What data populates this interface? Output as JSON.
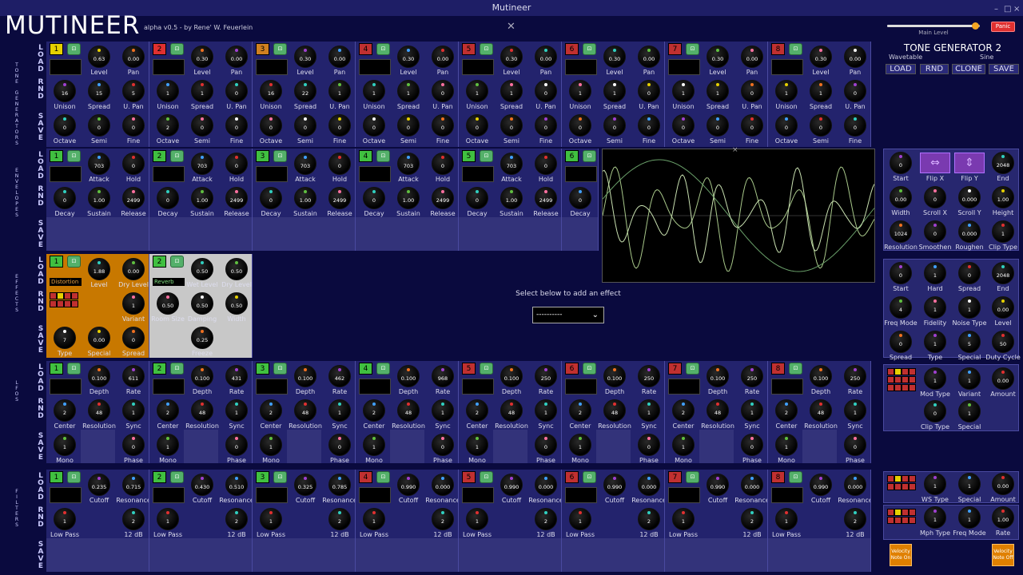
{
  "window": {
    "title": "Mutineer",
    "controls": [
      "–",
      "□",
      "×"
    ]
  },
  "header": {
    "app_title": "MUTINEER",
    "version": "alpha v0.5 - by Rene' W. Feuerlein",
    "main_level_label": "Main Level",
    "main_level": 0.95,
    "panic": "Panic"
  },
  "rows": {
    "load": "LOAD",
    "rnd": "RND",
    "save": "SAVE",
    "generators": "TONE GENERATORS",
    "envelopes": "ENVELOPES",
    "effects": "EFFECTS",
    "lfos": "LFOS",
    "filters": "FILTERS"
  },
  "generators": [
    {
      "n": "1",
      "c": "#e6d000",
      "k": [
        [
          "0.63",
          "Level"
        ],
        [
          "0.00",
          "Pan"
        ],
        [
          "16",
          "Unison"
        ],
        [
          "15",
          "Spread"
        ],
        [
          "5",
          "U. Pan"
        ],
        [
          "0",
          "Octave"
        ],
        [
          "0",
          "Semi"
        ],
        [
          "0",
          "Fine"
        ]
      ]
    },
    {
      "n": "2",
      "c": "#e03030",
      "k": [
        [
          "0.30",
          "Level"
        ],
        [
          "0.00",
          "Pan"
        ],
        [
          "1",
          "Unison"
        ],
        [
          "1",
          "Spread"
        ],
        [
          "0",
          "U. Pan"
        ],
        [
          "2",
          "Octave"
        ],
        [
          "0",
          "Semi"
        ],
        [
          "0",
          "Fine"
        ]
      ]
    },
    {
      "n": "3",
      "c": "#d08020",
      "k": [
        [
          "0.30",
          "Level"
        ],
        [
          "0.00",
          "Pan"
        ],
        [
          "16",
          "Unison"
        ],
        [
          "22",
          "Spread"
        ],
        [
          "1",
          "U. Pan"
        ],
        [
          "0",
          "Octave"
        ],
        [
          "0",
          "Semi"
        ],
        [
          "0",
          "Fine"
        ]
      ]
    },
    {
      "n": "4",
      "c": "#c03030",
      "k": [
        [
          "0.30",
          "Level"
        ],
        [
          "0.00",
          "Pan"
        ],
        [
          "1",
          "Unison"
        ],
        [
          "1",
          "Spread"
        ],
        [
          "0",
          "U. Pan"
        ],
        [
          "0",
          "Octave"
        ],
        [
          "0",
          "Semi"
        ],
        [
          "0",
          "Fine"
        ]
      ]
    },
    {
      "n": "5",
      "c": "#c03030",
      "k": [
        [
          "0.30",
          "Level"
        ],
        [
          "0.00",
          "Pan"
        ],
        [
          "1",
          "Unison"
        ],
        [
          "1",
          "Spread"
        ],
        [
          "0",
          "U. Pan"
        ],
        [
          "0",
          "Octave"
        ],
        [
          "0",
          "Semi"
        ],
        [
          "0",
          "Fine"
        ]
      ]
    },
    {
      "n": "6",
      "c": "#c03030",
      "k": [
        [
          "0.30",
          "Level"
        ],
        [
          "0.00",
          "Pan"
        ],
        [
          "1",
          "Unison"
        ],
        [
          "1",
          "Spread"
        ],
        [
          "0",
          "U. Pan"
        ],
        [
          "0",
          "Octave"
        ],
        [
          "0",
          "Semi"
        ],
        [
          "0",
          "Fine"
        ]
      ]
    },
    {
      "n": "7",
      "c": "#c03030",
      "k": [
        [
          "0.30",
          "Level"
        ],
        [
          "0.00",
          "Pan"
        ],
        [
          "1",
          "Unison"
        ],
        [
          "1",
          "Spread"
        ],
        [
          "0",
          "U. Pan"
        ],
        [
          "0",
          "Octave"
        ],
        [
          "0",
          "Semi"
        ],
        [
          "0",
          "Fine"
        ]
      ]
    },
    {
      "n": "8",
      "c": "#c03030",
      "k": [
        [
          "0.30",
          "Level"
        ],
        [
          "0.00",
          "Pan"
        ],
        [
          "1",
          "Unison"
        ],
        [
          "1",
          "Spread"
        ],
        [
          "0",
          "U. Pan"
        ],
        [
          "0",
          "Octave"
        ],
        [
          "0",
          "Semi"
        ],
        [
          "0",
          "Fine"
        ]
      ]
    }
  ],
  "envelopes": [
    {
      "n": "1",
      "k": [
        [
          "703",
          "Attack"
        ],
        [
          "0",
          "Hold"
        ],
        [
          "0",
          "Decay"
        ],
        [
          "1.00",
          "Sustain"
        ],
        [
          "2499",
          "Release"
        ]
      ]
    },
    {
      "n": "2",
      "k": [
        [
          "703",
          "Attack"
        ],
        [
          "0",
          "Hold"
        ],
        [
          "0",
          "Decay"
        ],
        [
          "1.00",
          "Sustain"
        ],
        [
          "2499",
          "Release"
        ]
      ]
    },
    {
      "n": "3",
      "k": [
        [
          "703",
          "Attack"
        ],
        [
          "0",
          "Hold"
        ],
        [
          "0",
          "Decay"
        ],
        [
          "1.00",
          "Sustain"
        ],
        [
          "2499",
          "Release"
        ]
      ]
    },
    {
      "n": "4",
      "k": [
        [
          "703",
          "Attack"
        ],
        [
          "0",
          "Hold"
        ],
        [
          "0",
          "Decay"
        ],
        [
          "1.00",
          "Sustain"
        ],
        [
          "2499",
          "Release"
        ]
      ]
    },
    {
      "n": "5",
      "k": [
        [
          "703",
          "Attack"
        ],
        [
          "0",
          "Hold"
        ],
        [
          "0",
          "Decay"
        ],
        [
          "1.00",
          "Sustain"
        ],
        [
          "2499",
          "Release"
        ]
      ]
    },
    {
      "n": "6",
      "k": [
        [
          "0",
          "Decay"
        ]
      ]
    }
  ],
  "effects": [
    {
      "n": "1",
      "name": "Distortion",
      "k": [
        [
          "1.88",
          "Level"
        ],
        [
          "0.00",
          "Dry Level"
        ],
        [
          "1",
          "Variant"
        ],
        [
          "7",
          "Type"
        ],
        [
          "0.00",
          "Special"
        ],
        [
          "0",
          "Spread"
        ]
      ]
    },
    {
      "n": "2",
      "name": "Reverb",
      "k": [
        [
          "0.50",
          "Wet Level"
        ],
        [
          "0.50",
          "Dry Level"
        ],
        [
          "0.50",
          "Room Size"
        ],
        [
          "0.50",
          "Damping"
        ],
        [
          "0.50",
          "Width"
        ],
        [
          "0.25",
          "Freeze"
        ]
      ]
    }
  ],
  "effect_hint": "Select below to add an effect",
  "effect_select": "----------",
  "lfos": [
    {
      "n": "1",
      "k": [
        [
          "0.100",
          "Depth"
        ],
        [
          "611",
          "Rate"
        ],
        [
          "2",
          "Center"
        ],
        [
          "48",
          "Resolution"
        ],
        [
          "1",
          "Sync"
        ],
        [
          "1",
          "Mono"
        ],
        [
          "0",
          "Phase"
        ]
      ]
    },
    {
      "n": "2",
      "k": [
        [
          "0.100",
          "Depth"
        ],
        [
          "431",
          "Rate"
        ],
        [
          "2",
          "Center"
        ],
        [
          "48",
          "Resolution"
        ],
        [
          "1",
          "Sync"
        ],
        [
          "1",
          "Mono"
        ],
        [
          "0",
          "Phase"
        ]
      ]
    },
    {
      "n": "3",
      "k": [
        [
          "0.100",
          "Depth"
        ],
        [
          "462",
          "Rate"
        ],
        [
          "2",
          "Center"
        ],
        [
          "48",
          "Resolution"
        ],
        [
          "1",
          "Sync"
        ],
        [
          "1",
          "Mono"
        ],
        [
          "0",
          "Phase"
        ]
      ]
    },
    {
      "n": "4",
      "k": [
        [
          "0.100",
          "Depth"
        ],
        [
          "968",
          "Rate"
        ],
        [
          "2",
          "Center"
        ],
        [
          "48",
          "Resolution"
        ],
        [
          "1",
          "Sync"
        ],
        [
          "1",
          "Mono"
        ],
        [
          "0",
          "Phase"
        ]
      ]
    },
    {
      "n": "5",
      "k": [
        [
          "0.100",
          "Depth"
        ],
        [
          "250",
          "Rate"
        ],
        [
          "2",
          "Center"
        ],
        [
          "48",
          "Resolution"
        ],
        [
          "1",
          "Sync"
        ],
        [
          "1",
          "Mono"
        ],
        [
          "0",
          "Phase"
        ]
      ]
    },
    {
      "n": "6",
      "k": [
        [
          "0.100",
          "Depth"
        ],
        [
          "250",
          "Rate"
        ],
        [
          "2",
          "Center"
        ],
        [
          "48",
          "Resolution"
        ],
        [
          "1",
          "Sync"
        ],
        [
          "1",
          "Mono"
        ],
        [
          "0",
          "Phase"
        ]
      ]
    },
    {
      "n": "7",
      "k": [
        [
          "0.100",
          "Depth"
        ],
        [
          "250",
          "Rate"
        ],
        [
          "2",
          "Center"
        ],
        [
          "48",
          "Resolution"
        ],
        [
          "1",
          "Sync"
        ],
        [
          "1",
          "Mono"
        ],
        [
          "0",
          "Phase"
        ]
      ]
    },
    {
      "n": "8",
      "k": [
        [
          "0.100",
          "Depth"
        ],
        [
          "250",
          "Rate"
        ],
        [
          "2",
          "Center"
        ],
        [
          "48",
          "Resolution"
        ],
        [
          "1",
          "Sync"
        ],
        [
          "1",
          "Mono"
        ],
        [
          "0",
          "Phase"
        ]
      ]
    }
  ],
  "filters": [
    {
      "n": "1",
      "k": [
        [
          "0.235",
          "Cutoff"
        ],
        [
          "0.715",
          "Resonance"
        ],
        [
          "1",
          "Low Pass"
        ],
        [
          "2",
          "12 dB"
        ]
      ]
    },
    {
      "n": "2",
      "k": [
        [
          "0.430",
          "Cutoff"
        ],
        [
          "0.510",
          "Resonance"
        ],
        [
          "1",
          "Low Pass"
        ],
        [
          "2",
          "12 dB"
        ]
      ]
    },
    {
      "n": "3",
      "k": [
        [
          "0.325",
          "Cutoff"
        ],
        [
          "0.785",
          "Resonance"
        ],
        [
          "1",
          "Low Pass"
        ],
        [
          "2",
          "12 dB"
        ]
      ]
    },
    {
      "n": "4",
      "k": [
        [
          "0.990",
          "Cutoff"
        ],
        [
          "0.000",
          "Resonance"
        ],
        [
          "1",
          "Low Pass"
        ],
        [
          "2",
          "12 dB"
        ]
      ]
    },
    {
      "n": "5",
      "k": [
        [
          "0.990",
          "Cutoff"
        ],
        [
          "0.000",
          "Resonance"
        ],
        [
          "1",
          "Low Pass"
        ],
        [
          "2",
          "12 dB"
        ]
      ]
    },
    {
      "n": "6",
      "k": [
        [
          "0.990",
          "Cutoff"
        ],
        [
          "0.000",
          "Resonance"
        ],
        [
          "1",
          "Low Pass"
        ],
        [
          "2",
          "12 dB"
        ]
      ]
    },
    {
      "n": "7",
      "k": [
        [
          "0.990",
          "Cutoff"
        ],
        [
          "0.000",
          "Resonance"
        ],
        [
          "1",
          "Low Pass"
        ],
        [
          "2",
          "12 dB"
        ]
      ]
    },
    {
      "n": "8",
      "k": [
        [
          "0.990",
          "Cutoff"
        ],
        [
          "0.000",
          "Resonance"
        ],
        [
          "1",
          "Low Pass"
        ],
        [
          "2",
          "12 dB"
        ]
      ]
    }
  ],
  "right": {
    "title": "TONE GENERATOR 2",
    "sub1": "Wavetable",
    "sub2": "Sine",
    "buttons": [
      "LOAD",
      "RND",
      "CLONE",
      "SAVE"
    ],
    "p1": [
      [
        "0",
        "Start"
      ],
      [
        "",
        "Flip X"
      ],
      [
        "",
        "Flip Y"
      ],
      [
        "2048",
        "End"
      ],
      [
        "0.00",
        "Width"
      ],
      [
        "0",
        "Scroll X"
      ],
      [
        "0.000",
        "Scroll Y"
      ],
      [
        "1.00",
        "Height"
      ],
      [
        "1024",
        "Resolution"
      ],
      [
        "0",
        "Smoothen"
      ],
      [
        "0.000",
        "Roughen"
      ],
      [
        "1",
        "Clip Type"
      ]
    ],
    "p2": [
      [
        "0",
        "Start"
      ],
      [
        "1",
        "Hard"
      ],
      [
        "0",
        "Spread"
      ],
      [
        "2048",
        "End"
      ],
      [
        "4",
        "Freq Mode"
      ],
      [
        "1",
        "Fidelity"
      ],
      [
        "1",
        "Noise Type"
      ],
      [
        "0.00",
        "Level"
      ],
      [
        "0",
        "Spread"
      ],
      [
        "1",
        "Type"
      ],
      [
        "5",
        "Special"
      ],
      [
        "50",
        "Duty Cycle"
      ]
    ],
    "p3": [
      [
        "1",
        "Mod Type"
      ],
      [
        "1",
        "Variant"
      ],
      [
        "0.00",
        "Amount"
      ],
      [
        "0",
        "Clip Type"
      ],
      [
        "1",
        "Special"
      ]
    ],
    "p4": [
      [
        "1",
        "WS Type"
      ],
      [
        "1",
        "Special"
      ],
      [
        "0.00",
        "Amount"
      ]
    ],
    "p5": [
      [
        "1",
        "Mph Type"
      ],
      [
        "1",
        "Freq Mode"
      ],
      [
        "1.00",
        "Rate"
      ]
    ],
    "vel1": "Velocity Note On",
    "vel2": "Velocity Note Off"
  }
}
